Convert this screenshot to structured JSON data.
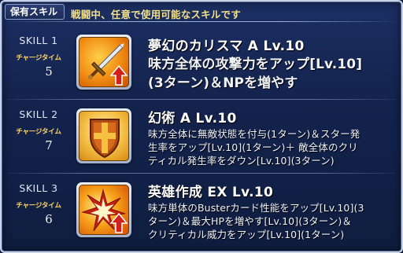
{
  "header": {
    "tab_label": "保有スキル",
    "subtitle": "戦闘中、任意で使用可能なスキルです"
  },
  "skills": [
    {
      "slot_label": "SKILL 1",
      "charge_label": "チャージタイム",
      "charge_value": "5",
      "icon": "sword-attack-up-icon",
      "title": "夢幻のカリスマ A Lv.10",
      "desc_lines": [
        "味方全体の攻撃力をアップ[Lv.10]",
        "(3ターン)＆NPを増やす"
      ]
    },
    {
      "slot_label": "SKILL 2",
      "charge_label": "チャージタイム",
      "charge_value": "7",
      "icon": "shield-cross-icon",
      "title": "幻術 A Lv.10",
      "desc_lines": [
        "味方全体に無敵状態を付与(1ターン)＆スター発",
        "生率をアップ[Lv.10](1ターン)＋ 敵全体のクリ",
        "ティカル発生率をダウン[Lv.10](3ターン)"
      ]
    },
    {
      "slot_label": "SKILL 3",
      "charge_label": "チャージタイム",
      "charge_value": "6",
      "icon": "buster-burst-up-icon",
      "title": "英雄作成 EX Lv.10",
      "desc_lines": [
        "味方単体のBusterカード性能をアップ[Lv.10](3",
        "ターン)＆最大HPを増やす[Lv.10](3ターン)＆",
        "クリティカル威力をアップ[Lv.10](1ターン)"
      ]
    }
  ]
}
